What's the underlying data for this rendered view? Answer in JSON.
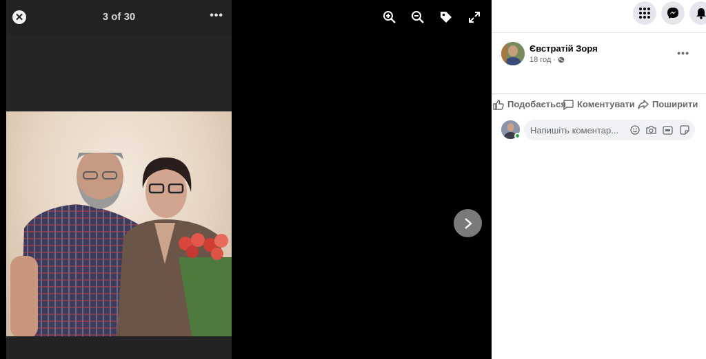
{
  "viewer": {
    "counter": "3 of 30",
    "more_label": "•••"
  },
  "panel": {
    "author": "Євстратій Зоря",
    "time": "18 год",
    "dot": "·",
    "post_more": "•••",
    "actions": {
      "like": "Подобається",
      "comment": "Коментувати",
      "share": "Поширити"
    },
    "comment_placeholder": "Напишіть коментар..."
  },
  "colors": {
    "accent_online": "#31a24c",
    "panel_bg": "#ffffff",
    "viewer_bg": "#000000"
  },
  "icons": [
    "close-icon",
    "zoom-in-icon",
    "zoom-out-icon",
    "tag-icon",
    "fullscreen-icon",
    "chevron-right-icon",
    "apps-grid-icon",
    "messenger-icon",
    "bell-icon",
    "globe-icon",
    "like-icon",
    "comment-icon",
    "share-icon",
    "emoji-icon",
    "camera-icon",
    "gif-icon",
    "sticker-icon"
  ]
}
